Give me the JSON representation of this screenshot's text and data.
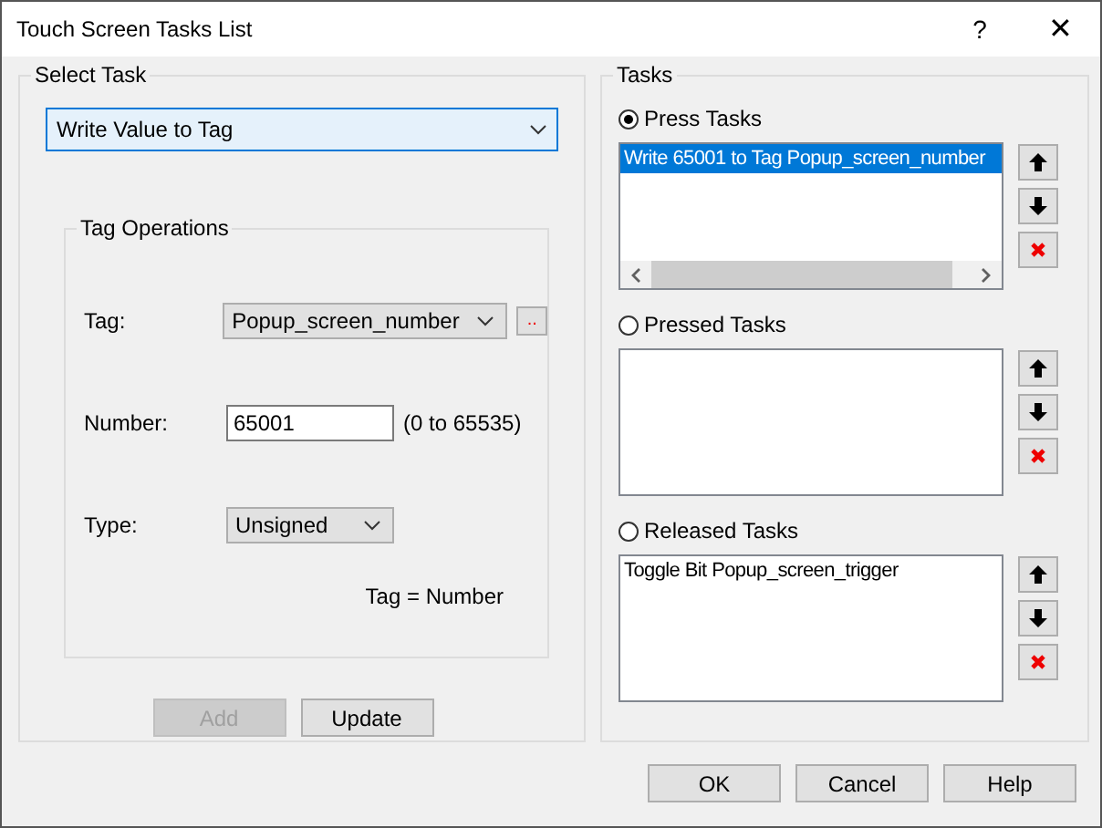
{
  "window": {
    "title": "Touch Screen Tasks List",
    "help_button": "?",
    "close_button": "✕"
  },
  "select_task": {
    "legend": "Select Task",
    "value": "Write Value to Tag"
  },
  "tag_operations": {
    "legend": "Tag Operations",
    "fields": [
      {
        "kind": "select",
        "label": "Tag:",
        "value": "Popup_screen_number",
        "browse": ".."
      },
      {
        "kind": "input",
        "label": "Number:",
        "value": "65001",
        "hint": "(0 to 65535)"
      },
      {
        "kind": "select-small",
        "label": "Type:",
        "value": "Unsigned"
      }
    ],
    "formula": "Tag = Number"
  },
  "actions": [
    {
      "label": "Add",
      "disabled": true
    },
    {
      "label": "Update",
      "disabled": false
    }
  ],
  "tasks": {
    "legend": "Tasks",
    "groups": [
      {
        "label": "Press Tasks",
        "selected": true,
        "scrollbar": true,
        "items": [
          {
            "text": "Write 65001 to Tag Popup_screen_number",
            "selected": true
          }
        ]
      },
      {
        "label": "Pressed Tasks",
        "selected": false,
        "scrollbar": false
      },
      {
        "label": "Released Tasks",
        "selected": false,
        "scrollbar": false,
        "items": [
          {
            "text": "Toggle Bit  Popup_screen_trigger",
            "selected": false
          }
        ]
      }
    ]
  },
  "buttons": [
    "OK",
    "Cancel",
    "Help"
  ]
}
